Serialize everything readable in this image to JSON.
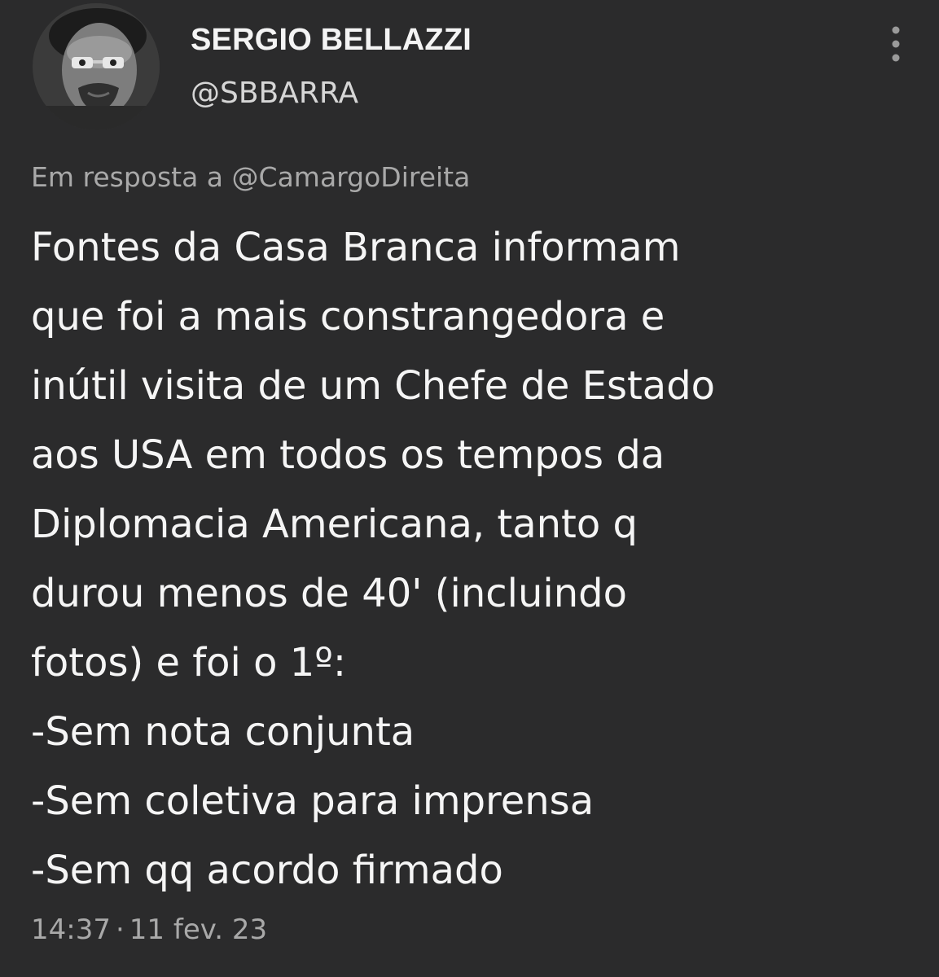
{
  "author": {
    "name": "SERGIO BELLAZZI",
    "handle": "@SBBARRA",
    "avatar_icon": "user-photo-avatar"
  },
  "more_icon": "vertical-ellipsis-icon",
  "reply": {
    "prefix": "Em resposta a",
    "mention": "@CamargoDireita"
  },
  "body_lines": [
    "Fontes da Casa Branca informam",
    "que foi a mais constrangedora e",
    "inútil visita de um Chefe de Estado",
    "aos USA em todos os tempos da",
    "Diplomacia Americana, tanto q",
    "durou menos de 40' (incluindo",
    "fotos) e foi o 1º:",
    "-Sem nota conjunta",
    "-Sem coletiva para imprensa",
    "-Sem qq acordo firmado"
  ],
  "meta": {
    "time": "14:37",
    "separator": "·",
    "date": "11 fev. 23"
  },
  "colors": {
    "background": "#2b2b2c",
    "text": "#f5f5f5",
    "muted": "#a9a9a9"
  }
}
